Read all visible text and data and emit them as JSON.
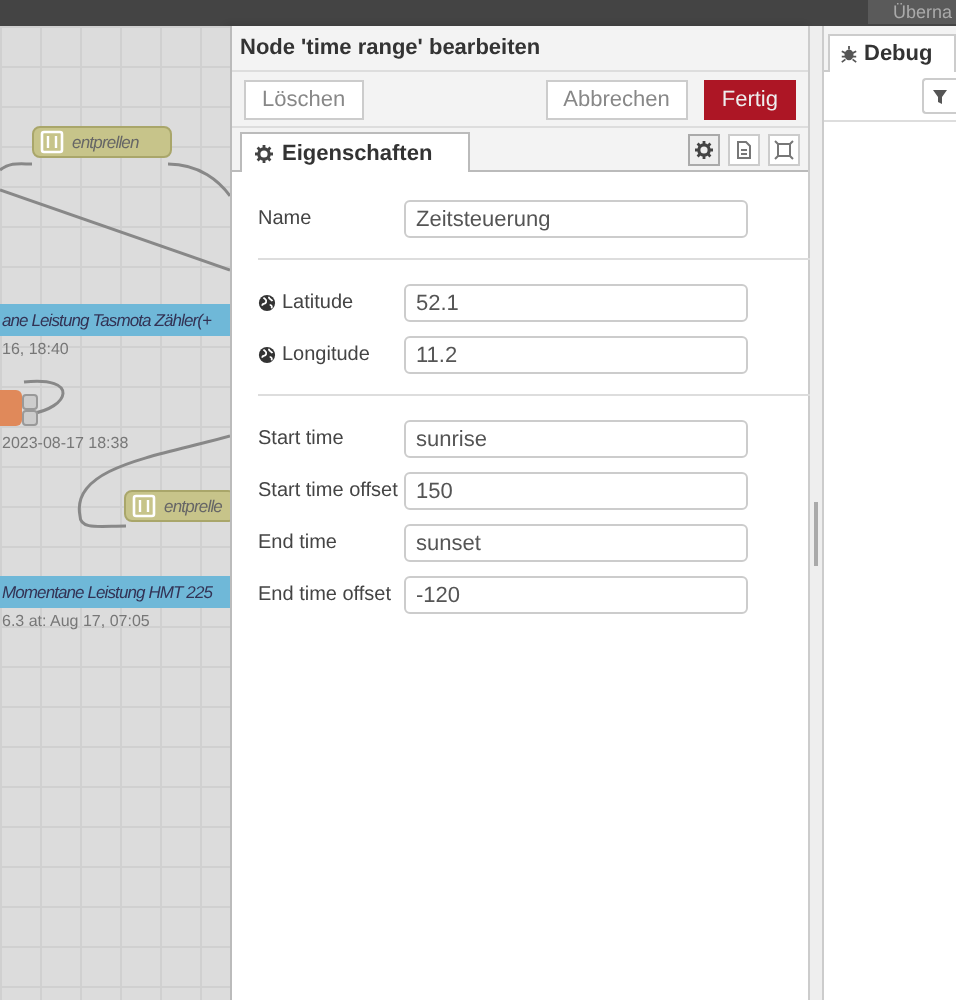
{
  "header": {
    "deploy_button": "Überna"
  },
  "flow": {
    "items": [
      {
        "kind": "node",
        "label": "entprellen"
      },
      {
        "kind": "bar",
        "label": "ane Leistung Tasmota Zähler(+"
      },
      {
        "kind": "status",
        "label": "16, 18:40"
      },
      {
        "kind": "status",
        "label": "2023-08-17 18:38"
      },
      {
        "kind": "node",
        "label": "entprelle"
      },
      {
        "kind": "bar",
        "label": "Momentane Leistung HMT 225"
      },
      {
        "kind": "status",
        "label": "6.3 at: Aug 17, 07:05"
      }
    ]
  },
  "editor": {
    "title": "Node 'time range' bearbeiten",
    "buttons": [
      {
        "kind": "delete",
        "label": "Löschen"
      },
      {
        "kind": "cancel",
        "label": "Abbrechen"
      },
      {
        "kind": "primary",
        "label": "Fertig"
      }
    ],
    "tabs": [
      {
        "label": "Eigenschaften",
        "selected": true
      }
    ],
    "sections": [
      [
        {
          "kind": "text",
          "label": "Name",
          "value": "Zeitsteuerung"
        }
      ],
      [
        {
          "kind": "location",
          "label": "Latitude",
          "value": "52.1"
        },
        {
          "kind": "location",
          "label": "Longitude",
          "value": "11.2"
        }
      ],
      [
        {
          "kind": "text",
          "label": "Start time",
          "value": "sunrise"
        },
        {
          "kind": "text",
          "label": "Start time offset",
          "value": "150"
        },
        {
          "kind": "text",
          "label": "End time",
          "value": "sunset"
        },
        {
          "kind": "text",
          "label": "End time offset",
          "value": "-120"
        }
      ]
    ]
  },
  "sidebar": {
    "tabs": [
      {
        "label": "Debug",
        "selected": true
      }
    ]
  }
}
